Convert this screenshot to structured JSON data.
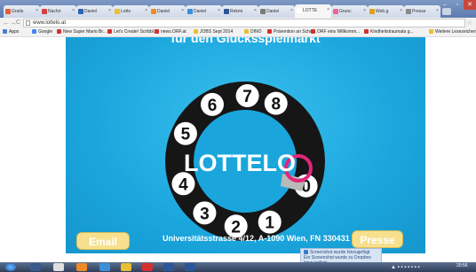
{
  "browser": {
    "tabs": [
      {
        "label": "Gratis",
        "favicon": "#e0603a",
        "active": false
      },
      {
        "label": "Nachri",
        "favicon": "#d93f3f",
        "active": false
      },
      {
        "label": "Daniel",
        "favicon": "#2d62b5",
        "active": false
      },
      {
        "label": "Lotto",
        "favicon": "#e8bf30",
        "active": false
      },
      {
        "label": "Daniel",
        "favicon": "#f08a24",
        "active": false
      },
      {
        "label": "Daniel",
        "favicon": "#3b8fd8",
        "active": false
      },
      {
        "label": "Rekmi",
        "favicon": "#2b5797",
        "active": false
      },
      {
        "label": "Daniel",
        "favicon": "#7a7a7a",
        "active": false
      },
      {
        "label": "LOTTE",
        "favicon": "#ffffff",
        "active": true
      },
      {
        "label": "Grunc",
        "favicon": "#f06292",
        "active": false
      },
      {
        "label": "Web.g",
        "favicon": "#e0a020",
        "active": false
      },
      {
        "label": "Presse",
        "favicon": "#8a8a8a",
        "active": false
      }
    ],
    "url": "www.lottelo.at",
    "bookmarks": [
      {
        "label": "Apps",
        "color": "#4a7fd4"
      },
      {
        "label": "Google",
        "color": "#4285f4"
      },
      {
        "label": "New Super Mario Br...",
        "color": "#d3302f"
      },
      {
        "label": "Let's Create! Scribbl...",
        "color": "#d3302f"
      },
      {
        "label": "news.ORF.at",
        "color": "#d3302f"
      },
      {
        "label": "JOBS Sept 2014",
        "color": "#e8bf30"
      },
      {
        "label": "DINO",
        "color": "#e8bf30"
      },
      {
        "label": "Prävention an Schul...",
        "color": "#d3302f"
      },
      {
        "label": "ORF eins Willkomm...",
        "color": "#d3302f"
      },
      {
        "label": "Kindheitstraumata g...",
        "color": "#d3302f"
      },
      {
        "label": "Weitere Lesezeichen",
        "color": "#e8bf30"
      }
    ]
  },
  "page": {
    "headline": "für den Glücksspielmarkt",
    "logo": "LOTTELO",
    "dial_numbers": [
      "8",
      "7",
      "6",
      "5",
      "4",
      "3",
      "2",
      "1",
      "0"
    ],
    "email_button": "Email",
    "presse_button": "Presse",
    "address": "Universitätsstrasse 4/12, A-1090 Wien, FN 330431 d",
    "colors": {
      "background": "#1aa6dd",
      "button": "#f7e08d",
      "dial": "#1a1a1a",
      "accent": "#e2267a"
    }
  },
  "notification": {
    "title": "Screenshot wurde hinzugefügt",
    "body": "Ein Screenshot wurde zu Dropbox hinzugefügt"
  },
  "taskbar": {
    "clock": "20:56"
  }
}
